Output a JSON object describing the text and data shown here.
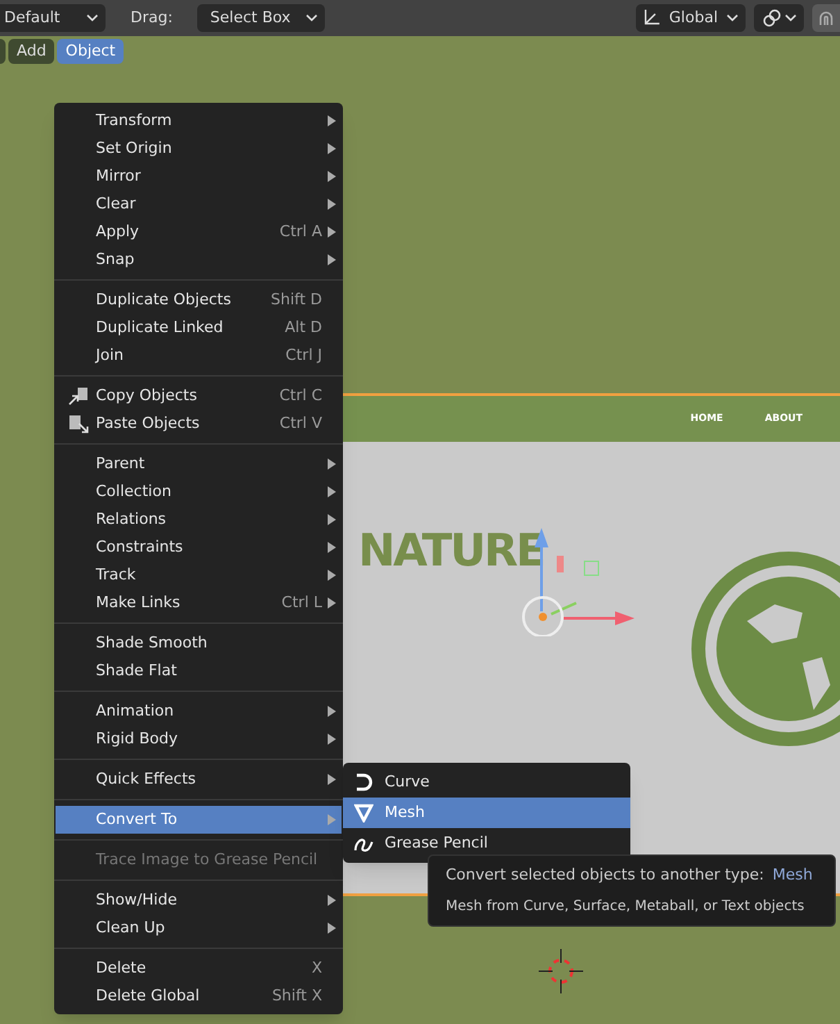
{
  "top_bar": {
    "mode_value": "Default",
    "drag_label": "Drag:",
    "drag_value": "Select Box",
    "orientation_value": "Global"
  },
  "header_menu": [
    {
      "label": "Add",
      "selected": false
    },
    {
      "label": "Object",
      "selected": true
    }
  ],
  "viewport": {
    "nav_items": [
      "HOME",
      "ABOUT"
    ],
    "heading": "NATURE"
  },
  "menu": {
    "items": [
      {
        "kind": "item",
        "label": "Transform",
        "submenu": true,
        "selected": false,
        "disabled": false
      },
      {
        "kind": "item",
        "label": "Set Origin",
        "submenu": true,
        "selected": false,
        "disabled": false
      },
      {
        "kind": "item",
        "label": "Mirror",
        "submenu": true,
        "selected": false,
        "disabled": false
      },
      {
        "kind": "item",
        "label": "Clear",
        "submenu": true,
        "selected": false,
        "disabled": false
      },
      {
        "kind": "item",
        "label": "Apply",
        "shortcut": "Ctrl A",
        "submenu": true,
        "selected": false,
        "disabled": false
      },
      {
        "kind": "item",
        "label": "Snap",
        "submenu": true,
        "selected": false,
        "disabled": false
      },
      {
        "kind": "separator"
      },
      {
        "kind": "item",
        "label": "Duplicate Objects",
        "shortcut": "Shift D",
        "submenu": false,
        "selected": false,
        "disabled": false
      },
      {
        "kind": "item",
        "label": "Duplicate Linked",
        "shortcut": "Alt D",
        "submenu": false,
        "selected": false,
        "disabled": false
      },
      {
        "kind": "item",
        "label": "Join",
        "shortcut": "Ctrl J",
        "submenu": false,
        "selected": false,
        "disabled": false
      },
      {
        "kind": "separator"
      },
      {
        "kind": "copy",
        "label": "Copy Objects",
        "shortcut": "Ctrl C",
        "submenu": false,
        "selected": false,
        "disabled": false
      },
      {
        "kind": "paste",
        "label": "Paste Objects",
        "shortcut": "Ctrl V",
        "submenu": false,
        "selected": false,
        "disabled": false
      },
      {
        "kind": "separator"
      },
      {
        "kind": "item",
        "label": "Parent",
        "submenu": true,
        "selected": false,
        "disabled": false
      },
      {
        "kind": "item",
        "label": "Collection",
        "submenu": true,
        "selected": false,
        "disabled": false
      },
      {
        "kind": "item",
        "label": "Relations",
        "submenu": true,
        "selected": false,
        "disabled": false
      },
      {
        "kind": "item",
        "label": "Constraints",
        "submenu": true,
        "selected": false,
        "disabled": false
      },
      {
        "kind": "item",
        "label": "Track",
        "submenu": true,
        "selected": false,
        "disabled": false
      },
      {
        "kind": "item",
        "label": "Make Links",
        "shortcut": "Ctrl L",
        "submenu": true,
        "selected": false,
        "disabled": false
      },
      {
        "kind": "separator"
      },
      {
        "kind": "item",
        "label": "Shade Smooth",
        "submenu": false,
        "selected": false,
        "disabled": false
      },
      {
        "kind": "item",
        "label": "Shade Flat",
        "submenu": false,
        "selected": false,
        "disabled": false
      },
      {
        "kind": "separator"
      },
      {
        "kind": "item",
        "label": "Animation",
        "submenu": true,
        "selected": false,
        "disabled": false
      },
      {
        "kind": "item",
        "label": "Rigid Body",
        "submenu": true,
        "selected": false,
        "disabled": false
      },
      {
        "kind": "separator"
      },
      {
        "kind": "item",
        "label": "Quick Effects",
        "submenu": true,
        "selected": false,
        "disabled": false
      },
      {
        "kind": "separator"
      },
      {
        "kind": "item",
        "label": "Convert To",
        "submenu": true,
        "selected": true,
        "disabled": false
      },
      {
        "kind": "separator"
      },
      {
        "kind": "item",
        "label": "Trace Image to Grease Pencil",
        "submenu": false,
        "selected": false,
        "disabled": true
      },
      {
        "kind": "separator"
      },
      {
        "kind": "item",
        "label": "Show/Hide",
        "submenu": true,
        "selected": false,
        "disabled": false
      },
      {
        "kind": "item",
        "label": "Clean Up",
        "submenu": true,
        "selected": false,
        "disabled": false
      },
      {
        "kind": "separator"
      },
      {
        "kind": "item",
        "label": "Delete",
        "shortcut": "X",
        "submenu": false,
        "selected": false,
        "disabled": false
      },
      {
        "kind": "item",
        "label": "Delete Global",
        "shortcut": "Shift X",
        "submenu": false,
        "selected": false,
        "disabled": false
      }
    ]
  },
  "submenu": {
    "items": [
      {
        "kind": "curve",
        "label": "Curve",
        "selected": false
      },
      {
        "kind": "mesh",
        "label": "Mesh",
        "selected": true
      },
      {
        "kind": "grease_pencil",
        "label": "Grease Pencil",
        "selected": false
      }
    ]
  },
  "tooltip": {
    "text": "Convert selected objects to another type:",
    "value": "Mesh",
    "description": "Mesh from Curve, Surface, Metaball, or Text objects"
  }
}
